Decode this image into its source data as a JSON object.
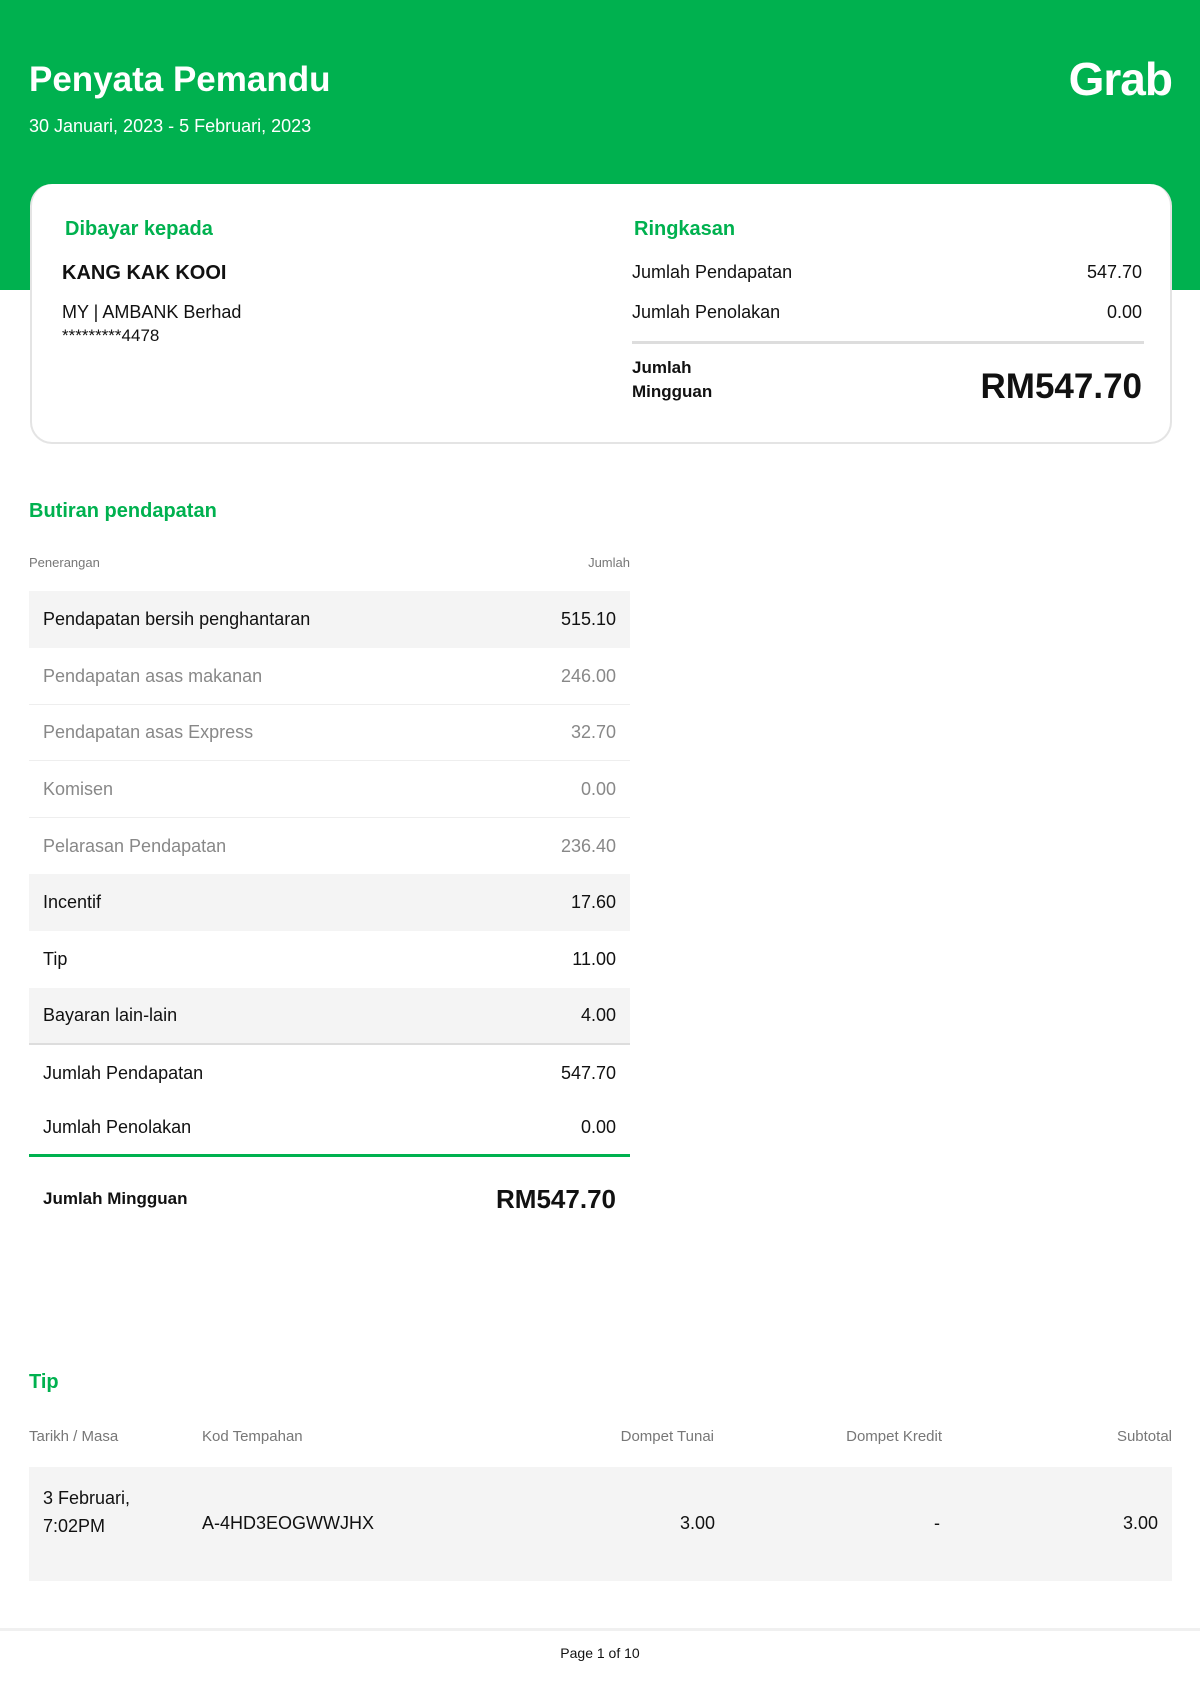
{
  "header": {
    "title": "Penyata Pemandu",
    "period": "30 Januari, 2023 - 5 Februari, 2023",
    "logo": "Grab"
  },
  "paid_to": {
    "heading": "Dibayar kepada",
    "name": "KANG KAK KOOI",
    "bank": "MY | AMBANK Berhad",
    "account": "*********4478"
  },
  "summary": {
    "heading": "Ringkasan",
    "earnings_label": "Jumlah Pendapatan",
    "earnings": "547.70",
    "deductions_label": "Jumlah Penolakan",
    "deductions": "0.00",
    "total_label_1": "Jumlah",
    "total_label_2": "Mingguan",
    "total": "RM547.70"
  },
  "earnings": {
    "heading": "Butiran pendapatan",
    "col_desc": "Penerangan",
    "col_amount": "Jumlah",
    "rows": [
      {
        "label": "Pendapatan bersih penghantaran",
        "value": "515.10"
      },
      {
        "label": "Pendapatan asas makanan",
        "value": "246.00"
      },
      {
        "label": "Pendapatan asas Express",
        "value": "32.70"
      },
      {
        "label": "Komisen",
        "value": "0.00"
      },
      {
        "label": "Pelarasan Pendapatan",
        "value": "236.40"
      },
      {
        "label": "Incentif",
        "value": "17.60"
      },
      {
        "label": "Tip",
        "value": "11.00"
      },
      {
        "label": "Bayaran lain-lain",
        "value": "4.00"
      },
      {
        "label": "Jumlah Pendapatan",
        "value": "547.70"
      },
      {
        "label": "Jumlah Penolakan",
        "value": "0.00"
      }
    ],
    "total_label": "Jumlah Mingguan",
    "total": "RM547.70"
  },
  "tips": {
    "heading": "Tip",
    "columns": [
      "Tarikh / Masa",
      "Kod Tempahan",
      "Dompet Tunai",
      "Dompet Kredit",
      "Subtotal"
    ],
    "rows": [
      {
        "date": "3 Februari,",
        "time": "7:02PM",
        "code": "A-4HD3EOGWWJHX",
        "cash": "3.00",
        "credit": "-",
        "subtotal": "3.00"
      }
    ]
  },
  "footer": {
    "page": "Page 1 of 10"
  }
}
